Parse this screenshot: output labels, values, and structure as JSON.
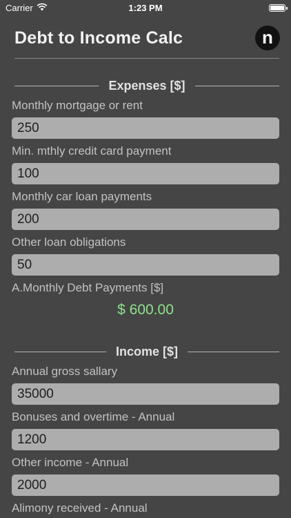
{
  "status_bar": {
    "carrier": "Carrier",
    "time": "1:23 PM"
  },
  "header": {
    "title": "Debt to Income Calc",
    "logo_letter": "n"
  },
  "expenses": {
    "title": "Expenses [$]",
    "fields": [
      {
        "label": "Monthly mortgage or rent",
        "value": "250"
      },
      {
        "label": "Min. mthly credit card payment",
        "value": "100"
      },
      {
        "label": "Monthly car loan payments",
        "value": "200"
      },
      {
        "label": "Other loan obligations",
        "value": "50"
      }
    ],
    "result_label": "A.Monthly Debt Payments [$]",
    "result_value": "$ 600.00"
  },
  "income": {
    "title": "Income [$]",
    "fields": [
      {
        "label": "Annual gross sallary",
        "value": "35000"
      },
      {
        "label": "Bonuses and overtime - Annual",
        "value": "1200"
      },
      {
        "label": "Other income - Annual",
        "value": "2000"
      },
      {
        "label": "Alimony received - Annual",
        "value": ""
      }
    ]
  },
  "colors": {
    "background": "#454545",
    "input_background": "#adadad",
    "result_green": "#8fe28c"
  }
}
